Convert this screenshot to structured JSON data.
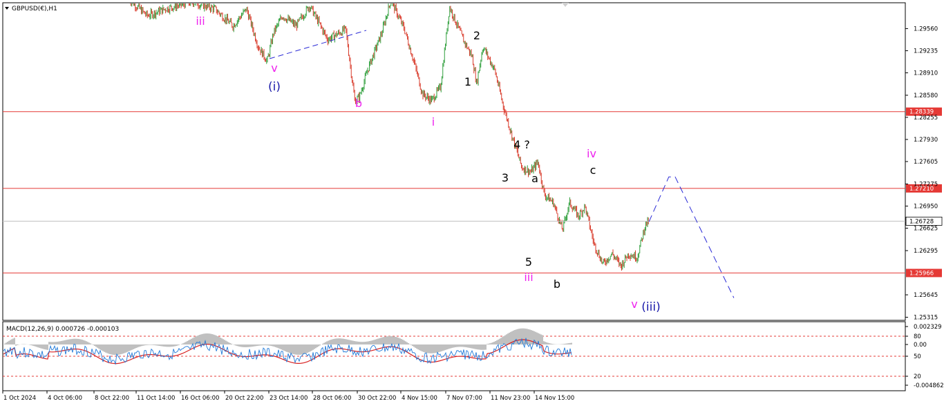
{
  "window": {
    "symbol_label": "GBPUSD(€),H1",
    "dropdown_icon": "triangle-down-icon"
  },
  "colors": {
    "bull_candle": "#2e9e3a",
    "bear_candle": "#d83a2a",
    "level_line": "#e53935",
    "level_label_bg": "#e53935",
    "current_price_bg": "#ffffff",
    "wave_pink": "#ee22ee",
    "wave_blue": "#1a1aaa",
    "projection_line": "#2a2ad6",
    "macd_histogram": "#c0c0c0",
    "macd_signal": "#d81e1e",
    "macd_rsi_line": "#1e78d8",
    "macd_levels": "#e53935"
  },
  "chart_data": [
    {
      "type": "line",
      "title": "GBPUSD(€),H1",
      "price_axis": {
        "ticks": [
          "1.29560",
          "1.29235",
          "1.28910",
          "1.28580",
          "1.28255",
          "1.27930",
          "1.27605",
          "1.27275",
          "1.26950",
          "1.26625",
          "1.26295",
          "1.25645",
          "1.25315"
        ],
        "ylim": [
          1.2528,
          1.2993
        ]
      },
      "levels": [
        {
          "value": "1.28339",
          "price": 1.28339
        },
        {
          "value": "1.27210",
          "price": 1.2721
        },
        {
          "value": "1.25966",
          "price": 1.25966
        }
      ],
      "current_price": {
        "value": "1.26728",
        "price": 1.26728
      },
      "time_axis": [
        "1 Oct 2024",
        "4 Oct 06:00",
        "8 Oct 22:00",
        "11 Oct 14:00",
        "16 Oct 06:00",
        "20 Oct 22:00",
        "23 Oct 14:00",
        "28 Oct 06:00",
        "30 Oct 22:00",
        "4 Nov 15:00",
        "7 Nov 07:00",
        "11 Nov 23:00",
        "14 Nov 15:00"
      ],
      "price_path": [
        {
          "x": 0.14,
          "y": 1.2999
        },
        {
          "x": 0.16,
          "y": 1.2975
        },
        {
          "x": 0.18,
          "y": 1.2985
        },
        {
          "x": 0.21,
          "y": 1.2995
        },
        {
          "x": 0.235,
          "y": 1.2985
        },
        {
          "x": 0.255,
          "y": 1.296
        },
        {
          "x": 0.27,
          "y": 1.2985
        },
        {
          "x": 0.283,
          "y": 1.293
        },
        {
          "x": 0.293,
          "y": 1.2908
        },
        {
          "x": 0.3,
          "y": 1.295
        },
        {
          "x": 0.31,
          "y": 1.2975
        },
        {
          "x": 0.325,
          "y": 1.296
        },
        {
          "x": 0.34,
          "y": 1.299
        },
        {
          "x": 0.36,
          "y": 1.294
        },
        {
          "x": 0.38,
          "y": 1.2955
        },
        {
          "x": 0.39,
          "y": 1.285
        },
        {
          "x": 0.395,
          "y": 1.2855
        },
        {
          "x": 0.405,
          "y": 1.2898
        },
        {
          "x": 0.42,
          "y": 1.295
        },
        {
          "x": 0.43,
          "y": 1.2998
        },
        {
          "x": 0.445,
          "y": 1.2955
        },
        {
          "x": 0.455,
          "y": 1.291
        },
        {
          "x": 0.465,
          "y": 1.286
        },
        {
          "x": 0.475,
          "y": 1.285
        },
        {
          "x": 0.485,
          "y": 1.287
        },
        {
          "x": 0.495,
          "y": 1.2988
        },
        {
          "x": 0.51,
          "y": 1.294
        },
        {
          "x": 0.52,
          "y": 1.2915
        },
        {
          "x": 0.525,
          "y": 1.2875
        },
        {
          "x": 0.532,
          "y": 1.293
        },
        {
          "x": 0.545,
          "y": 1.2895
        },
        {
          "x": 0.555,
          "y": 1.284
        },
        {
          "x": 0.565,
          "y": 1.2795
        },
        {
          "x": 0.575,
          "y": 1.2752
        },
        {
          "x": 0.585,
          "y": 1.2745
        },
        {
          "x": 0.593,
          "y": 1.276
        },
        {
          "x": 0.6,
          "y": 1.2712
        },
        {
          "x": 0.61,
          "y": 1.27
        },
        {
          "x": 0.62,
          "y": 1.266
        },
        {
          "x": 0.628,
          "y": 1.27
        },
        {
          "x": 0.638,
          "y": 1.268
        },
        {
          "x": 0.645,
          "y": 1.2695
        },
        {
          "x": 0.655,
          "y": 1.264
        },
        {
          "x": 0.665,
          "y": 1.261
        },
        {
          "x": 0.675,
          "y": 1.2625
        },
        {
          "x": 0.685,
          "y": 1.2607
        },
        {
          "x": 0.693,
          "y": 1.2625
        },
        {
          "x": 0.703,
          "y": 1.262
        },
        {
          "x": 0.712,
          "y": 1.2668
        },
        {
          "x": 0.716,
          "y": 1.2672
        }
      ],
      "wave_labels": [
        {
          "text": "iii",
          "color": "pink"
        },
        {
          "text": "v",
          "color": "pink"
        },
        {
          "text": "(i)",
          "color": "blue"
        },
        {
          "text": "b",
          "color": "pink"
        },
        {
          "text": "i",
          "color": "pink"
        },
        {
          "text": "2",
          "color": "black"
        },
        {
          "text": "1",
          "color": "black"
        },
        {
          "text": "4 ?",
          "color": "black"
        },
        {
          "text": "3",
          "color": "black"
        },
        {
          "text": "a",
          "color": "black"
        },
        {
          "text": "5",
          "color": "black"
        },
        {
          "text": "iii",
          "color": "pink"
        },
        {
          "text": "b",
          "color": "black"
        },
        {
          "text": "iv",
          "color": "pink"
        },
        {
          "text": "c",
          "color": "black"
        },
        {
          "text": "v",
          "color": "pink"
        },
        {
          "text": "(iii)",
          "color": "blue"
        }
      ],
      "projection": [
        {
          "x": 0.716,
          "y": 1.2672
        },
        {
          "x": 0.738,
          "y": 1.2738
        },
        {
          "x": 0.745,
          "y": 1.2738
        },
        {
          "x": 0.81,
          "y": 1.256
        }
      ]
    },
    {
      "type": "line",
      "title": "MACD(12,26,9) 0.000726 -0.000103",
      "right_ticks": [
        "0.002329",
        "80",
        "0.00",
        "50",
        "20",
        "-0.004862"
      ],
      "levels": [
        80,
        50,
        20
      ],
      "legend": "MACD(12,26,9) 0.000726 -0.000103"
    }
  ]
}
